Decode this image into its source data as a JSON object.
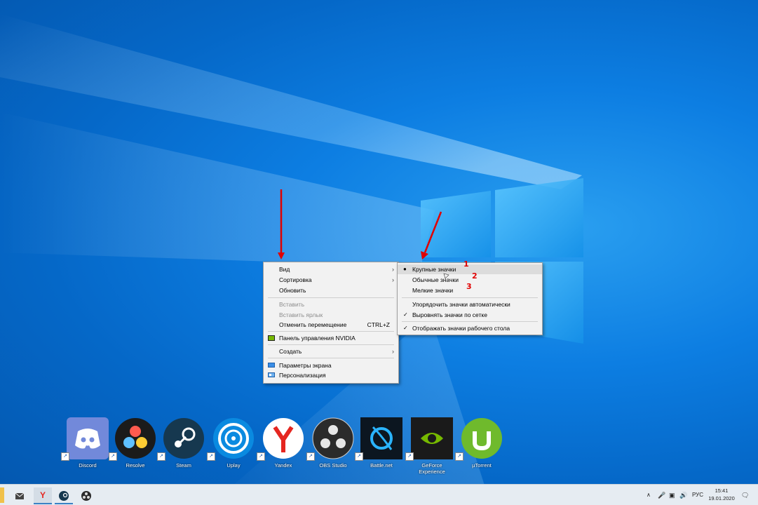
{
  "context_menu": {
    "items": [
      {
        "label": "Вид",
        "submenu": true
      },
      {
        "label": "Сортировка",
        "submenu": true
      },
      {
        "label": "Обновить"
      },
      {
        "label": "Вставить",
        "disabled": true
      },
      {
        "label": "Вставить ярлык",
        "disabled": true
      },
      {
        "label": "Отменить перемещение",
        "shortcut": "CTRL+Z"
      },
      {
        "label": "Панель управления NVIDIA",
        "icon": "nvidia-icon"
      },
      {
        "label": "Создать",
        "submenu": true
      },
      {
        "label": "Параметры экрана",
        "icon": "display-icon"
      },
      {
        "label": "Персонализация",
        "icon": "personalize-icon"
      }
    ]
  },
  "view_submenu": {
    "items": [
      {
        "label": "Крупные значки",
        "selected": true
      },
      {
        "label": "Обычные значки"
      },
      {
        "label": "Мелкие значки"
      },
      {
        "label": "Упорядочить значки автоматически"
      },
      {
        "label": "Выровнять значки по сетке",
        "checked": true
      },
      {
        "label": "Отображать значки рабочего стола",
        "checked": true
      }
    ]
  },
  "annotations": {
    "n1": "1",
    "n2": "2",
    "n3": "3",
    "color": "#e00000"
  },
  "desktop_icons": [
    {
      "label": "Discord",
      "icon": "discord-icon"
    },
    {
      "label": "Resolve",
      "icon": "resolve-icon"
    },
    {
      "label": "Steam",
      "icon": "steam-icon"
    },
    {
      "label": "Uplay",
      "icon": "uplay-icon"
    },
    {
      "label": "Yandex",
      "icon": "yandex-icon"
    },
    {
      "label": "OBS Studio",
      "icon": "obs-icon"
    },
    {
      "label": "Battle.net",
      "icon": "battlenet-icon"
    },
    {
      "label": "GeForce Experience",
      "icon": "geforce-icon"
    },
    {
      "label": "µTorrent",
      "icon": "utorrent-icon"
    }
  ],
  "taskbar": {
    "lang": "РУС",
    "time": "15:41",
    "date": "19.01.2020"
  }
}
